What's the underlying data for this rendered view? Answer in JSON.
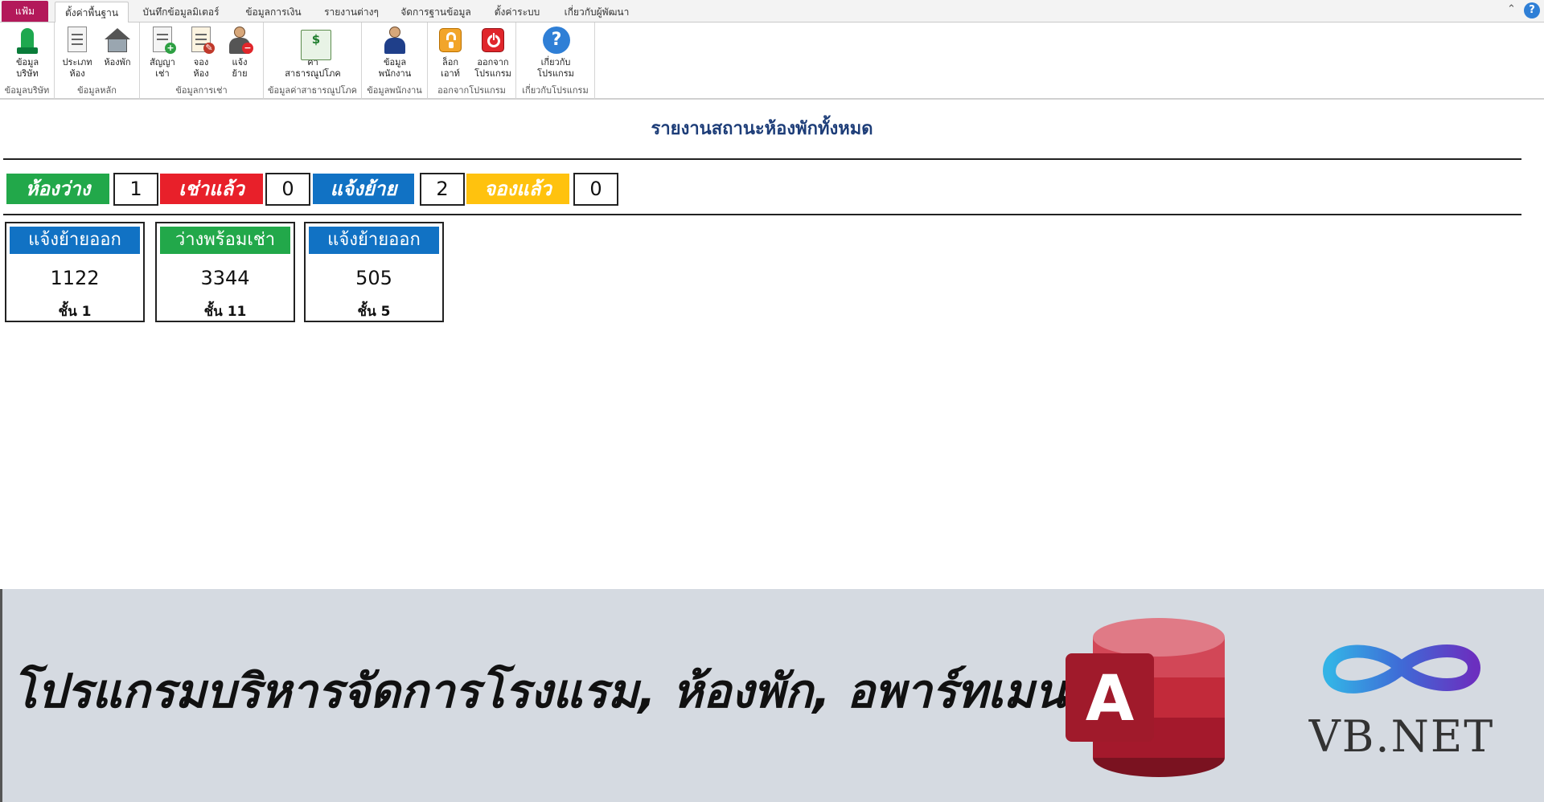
{
  "ribbon": {
    "tabs": [
      {
        "label": "แฟ้ม"
      },
      {
        "label": "ตั้งค่าพื้นฐาน"
      },
      {
        "label": "บันทึกข้อมูลมิเตอร์"
      },
      {
        "label": "ข้อมูลการเงิน"
      },
      {
        "label": "รายงานต่างๆ"
      },
      {
        "label": "จัดการฐานข้อมูล"
      },
      {
        "label": "ตั้งค่าระบบ"
      },
      {
        "label": "เกี่ยวกับผู้พัฒนา"
      }
    ],
    "groups": [
      {
        "label": "ข้อมูลบริษัท",
        "buttons": [
          {
            "label": "ข้อมูล\nบริษัท",
            "icon": "company-icon"
          }
        ]
      },
      {
        "label": "ข้อมูลหลัก",
        "buttons": [
          {
            "label": "ประเภท\nห้อง",
            "icon": "room-type-icon"
          },
          {
            "label": "ห้องพัก",
            "icon": "room-icon"
          }
        ]
      },
      {
        "label": "ข้อมูลการเช่า",
        "buttons": [
          {
            "label": "สัญญา\nเช่า",
            "icon": "contract-icon"
          },
          {
            "label": "จอง\nห้อง",
            "icon": "booking-icon"
          },
          {
            "label": "แจ้ง\nย้าย",
            "icon": "move-out-icon"
          }
        ]
      },
      {
        "label": "ข้อมูลค่าสาธารณูปโภค",
        "buttons": [
          {
            "label": "ค่า\nสาธารณูปโภค",
            "icon": "utility-bill-icon"
          }
        ]
      },
      {
        "label": "ข้อมูลพนักงาน",
        "buttons": [
          {
            "label": "ข้อมูล\nพนักงาน",
            "icon": "employee-icon"
          }
        ]
      },
      {
        "label": "ออกจากโปรแกรม",
        "buttons": [
          {
            "label": "ล็อก\nเอาท์",
            "icon": "lock-icon"
          },
          {
            "label": "ออกจาก\nโปรแกรม",
            "icon": "power-icon"
          }
        ]
      },
      {
        "label": "เกี่ยวกับโปรแกรม",
        "buttons": [
          {
            "label": "เกี่ยวกับ\nโปรแกรม",
            "icon": "help-icon"
          }
        ]
      }
    ]
  },
  "report": {
    "title": "รายงานสถานะห้องพักทั้งหมด",
    "legend": [
      {
        "label": "ห้องว่าง",
        "count": "1",
        "color": "#22a84a"
      },
      {
        "label": "เช่าแล้ว",
        "count": "0",
        "color": "#e8202a"
      },
      {
        "label": "แจ้งย้าย",
        "count": "2",
        "color": "#1172c4"
      },
      {
        "label": "จองแล้ว",
        "count": "0",
        "color": "#ffc20e"
      }
    ],
    "rooms": [
      {
        "status": "แจ้งย้ายออก",
        "number": "1122",
        "floor": "ชั้น 1",
        "color": "#1172c4"
      },
      {
        "status": "ว่างพร้อมเช่า",
        "number": "3344",
        "floor": "ชั้น 11",
        "color": "#22a84a"
      },
      {
        "status": "แจ้งย้ายออก",
        "number": "505",
        "floor": "ชั้น 5",
        "color": "#1172c4"
      }
    ]
  },
  "banner": {
    "text": "โปรแกรมบริหารจัดการโรงแรม, ห้องพัก, อพาร์ทเมนท์",
    "access_letter": "A",
    "vbnet_text": "VB.NET"
  },
  "colors": {
    "file_tab": "#b3195a",
    "title_text": "#1d3d78",
    "banner_bg": "#d5dae1"
  }
}
